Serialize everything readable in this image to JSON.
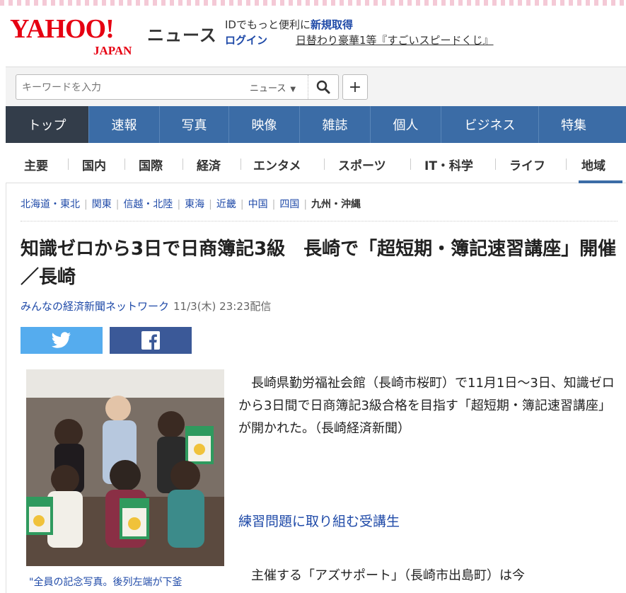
{
  "header": {
    "logo_main": "YAHOO!",
    "logo_sub": "JAPAN",
    "service": "ニュース",
    "id_text": "IDでもっと便利に",
    "register": "新規取得",
    "login": "ログイン",
    "promo": "日替わり豪華1等『すごいスピードくじ』"
  },
  "search": {
    "placeholder": "キーワードを入力",
    "category": "ニュース",
    "search_icon": "search-icon",
    "plus_label": "+"
  },
  "nav": {
    "tabs": [
      "トップ",
      "速報",
      "写真",
      "映像",
      "雑誌",
      "個人",
      "ビジネス",
      "特集"
    ]
  },
  "subnav": {
    "items": [
      "主要",
      "国内",
      "国際",
      "経済",
      "エンタメ",
      "スポーツ",
      "IT・科学",
      "ライフ",
      "地域"
    ]
  },
  "regions": {
    "items": [
      "北海道・東北",
      "関東",
      "信越・北陸",
      "東海",
      "近畿",
      "中国",
      "四国",
      "九州・沖縄"
    ]
  },
  "article": {
    "title": "知識ゼロから3日で日商簿記3級　長崎で「超短期・簿記速習講座」開催　／長崎",
    "source": "みんなの経済新聞ネットワーク",
    "date": "11/3(木) 23:23配信",
    "body1": "　長崎県勤労福祉会館（長崎市桜町）で11月1日～3日、知識ゼロから3日間で日商簿記3級合格を目指す「超短期・簿記速習講座」が開かれた。（長崎経済新聞）",
    "sublink": "練習問題に取り組む受講生",
    "body2": "　主催する「アズサポート」（長崎市出島町）は今",
    "caption": "\"全員の記念写真。後列左端が下釜"
  },
  "colors": {
    "nav_bg": "#3b6ca6",
    "nav_active": "#333d4a",
    "link": "#1f4aa8",
    "brand_red": "#e60012",
    "twitter": "#55acee",
    "facebook": "#3b5998"
  }
}
